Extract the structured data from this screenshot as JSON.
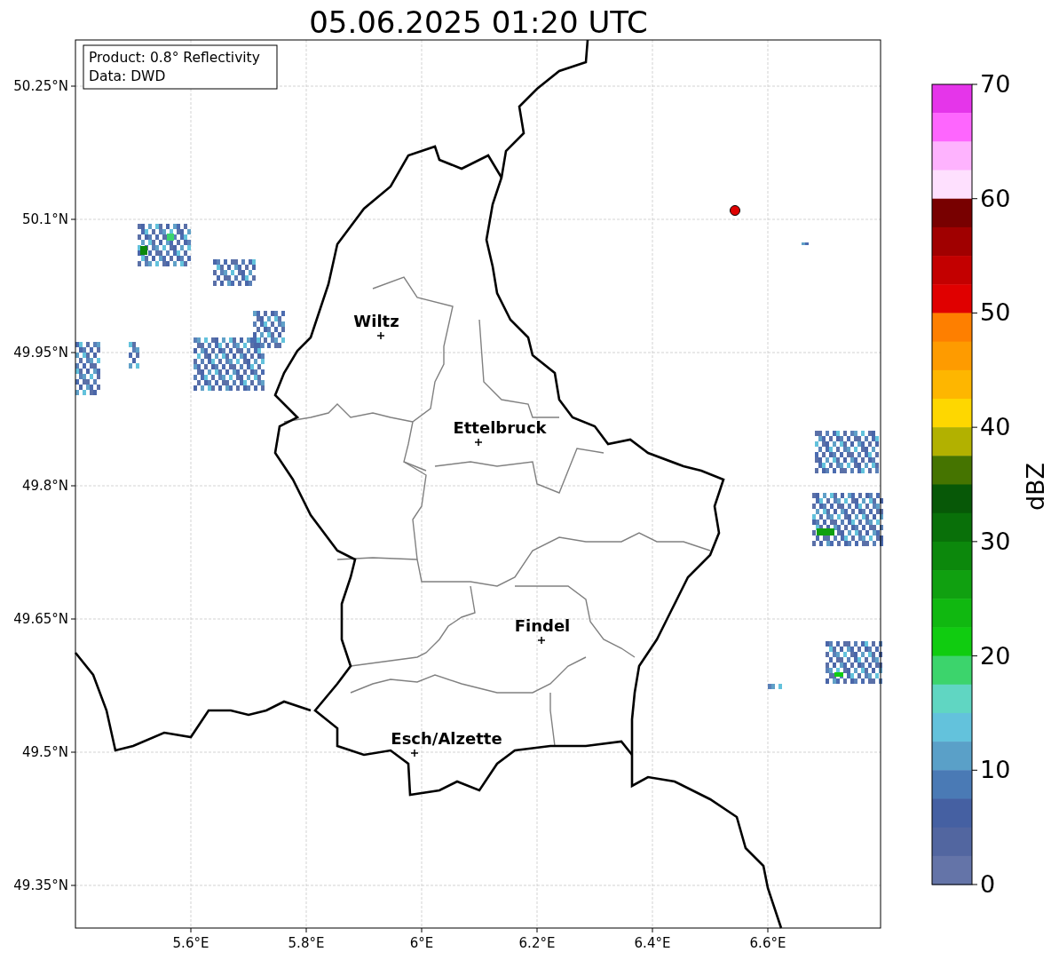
{
  "title": "05.06.2025 01:20 UTC",
  "info": [
    "Product: 0.8° Reflectivity",
    "Data: DWD"
  ],
  "lat_labels": [
    "50.25°N",
    "50.1°N",
    "49.95°N",
    "49.8°N",
    "49.65°N",
    "49.5°N",
    "49.35°N"
  ],
  "lon_labels": [
    "5.6°E",
    "5.8°E",
    "6°E",
    "6.2°E",
    "6.4°E",
    "6.6°E"
  ],
  "cities": [
    {
      "name": "Wiltz"
    },
    {
      "name": "Ettelbruck"
    },
    {
      "name": "Findel"
    },
    {
      "name": "Esch/Alzette"
    }
  ],
  "colorbar": {
    "label": "dBZ",
    "ticks": [
      "70",
      "60",
      "50",
      "40",
      "30",
      "20",
      "10",
      "0"
    ],
    "bands": [
      {
        "color": "#e535ea"
      },
      {
        "color": "#fe66fe"
      },
      {
        "color": "#feb3fe"
      },
      {
        "color": "#fee0fe"
      },
      {
        "color": "#780000"
      },
      {
        "color": "#a00000"
      },
      {
        "color": "#c30000"
      },
      {
        "color": "#e00000"
      },
      {
        "color": "#fe7f00"
      },
      {
        "color": "#fe9b00"
      },
      {
        "color": "#feb600"
      },
      {
        "color": "#fed700"
      },
      {
        "color": "#b2b100"
      },
      {
        "color": "#457400"
      },
      {
        "color": "#075807"
      },
      {
        "color": "#097009"
      },
      {
        "color": "#0c880c"
      },
      {
        "color": "#10a010"
      },
      {
        "color": "#10b810"
      },
      {
        "color": "#10cc10"
      },
      {
        "color": "#3cd46c"
      },
      {
        "color": "#60d6c2"
      },
      {
        "color": "#63c2dc"
      },
      {
        "color": "#5aa0c8"
      },
      {
        "color": "#4a7ab5"
      },
      {
        "color": "#4560a2"
      },
      {
        "color": "#5266a0"
      },
      {
        "color": "#6474a8"
      }
    ]
  }
}
